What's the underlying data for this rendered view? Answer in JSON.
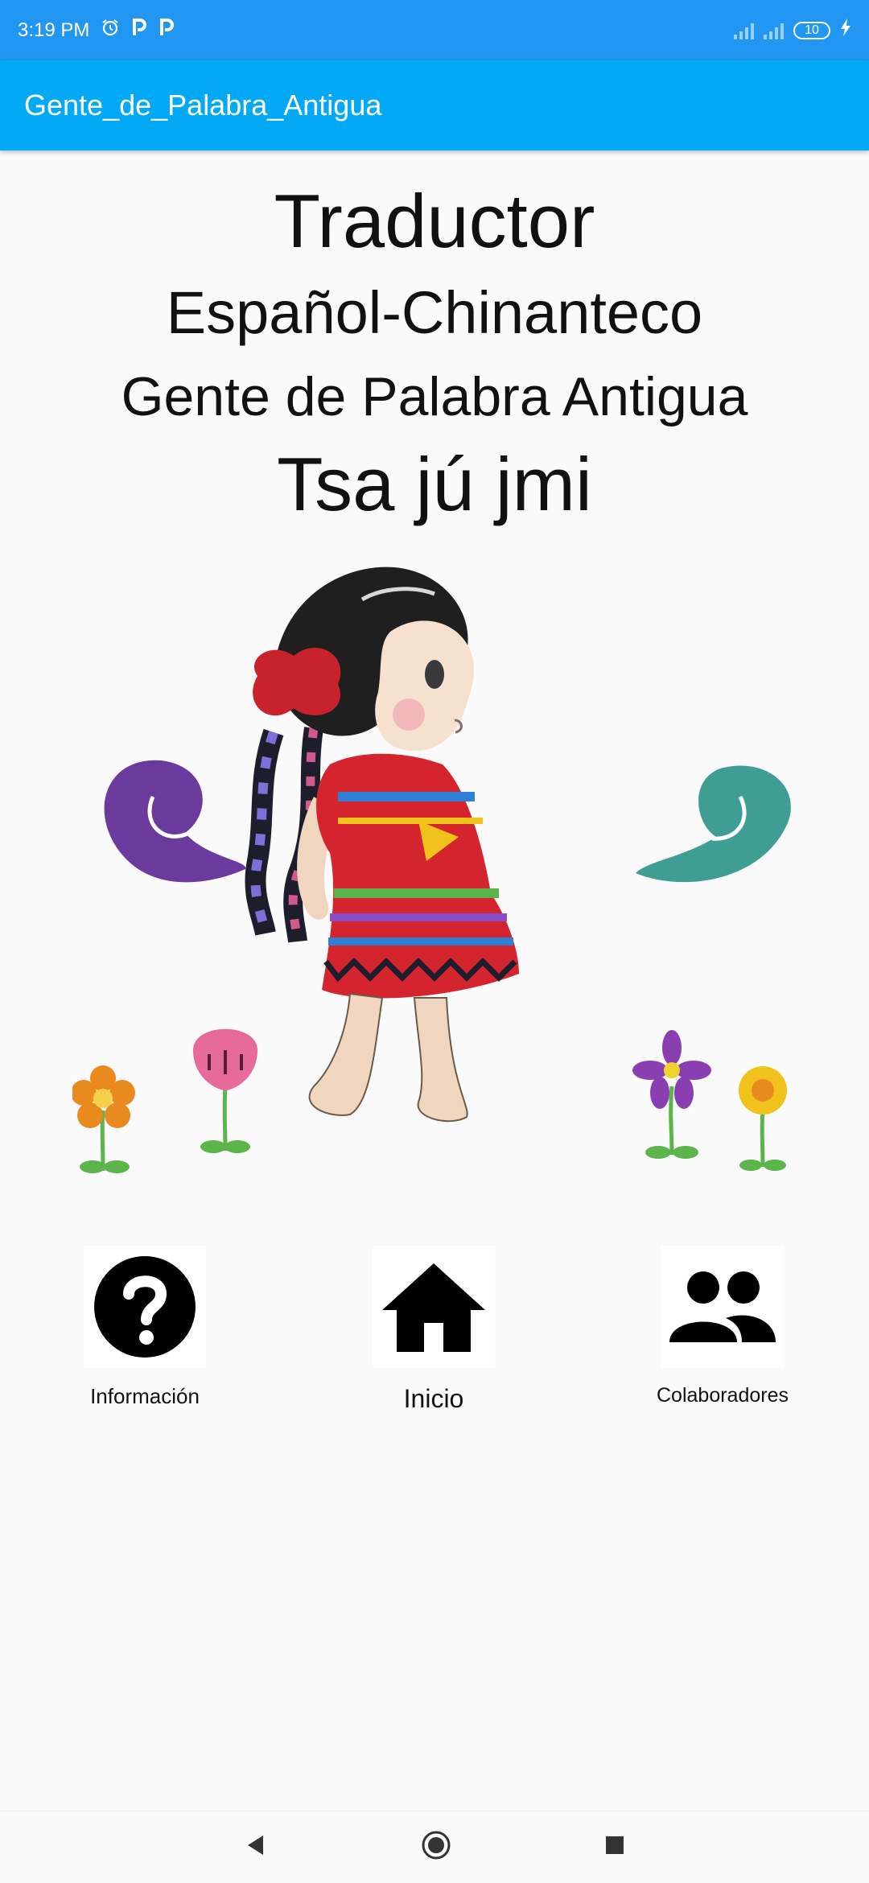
{
  "status_bar": {
    "time": "3:19 PM",
    "notification_icons": [
      "alarm-icon",
      "p-notification-icon",
      "p-notification-icon"
    ],
    "battery": "10"
  },
  "app_bar": {
    "title": "Gente_de_Palabra_Antigua"
  },
  "header": {
    "title": "Traductor",
    "subtitle": "Español-Chinanteco",
    "line3": "Gente de Palabra Antigua",
    "line4": "Tsa jú jmi"
  },
  "nav": [
    {
      "label": "Información",
      "icon": "question-circle-icon"
    },
    {
      "label": "Inicio",
      "icon": "home-icon"
    },
    {
      "label": "Colaboradores",
      "icon": "people-icon"
    }
  ],
  "system_nav": [
    "back-icon",
    "home-circle-icon",
    "recents-square-icon"
  ],
  "colors": {
    "status_bar": "#2196f3",
    "app_bar": "#03a9f4",
    "background": "#fafafa"
  }
}
